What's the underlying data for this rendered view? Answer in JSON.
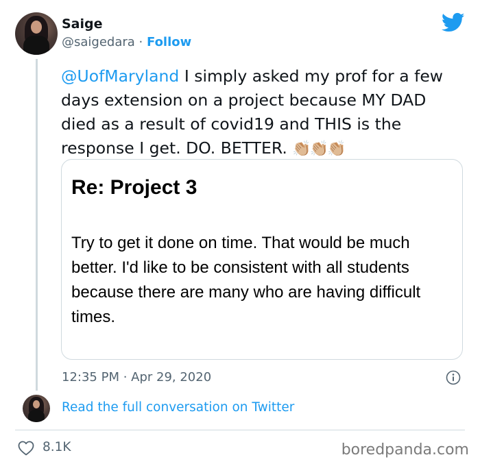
{
  "author": {
    "name": "Saige",
    "handle": "@saigedara",
    "separator": "·",
    "follow_label": "Follow"
  },
  "tweet": {
    "mention": "@UofMaryland",
    "text": " I simply asked my prof for a few days extension on a project because MY DAD died as a result of covid19 and THIS is the response I get. DO. BETTER. ",
    "emoji": "👏🏼👏🏼👏🏼"
  },
  "email_card": {
    "title": "Re:  Project 3",
    "body": "Try to get it done on time.  That would be much better.  I'd like to be consistent with all students because there are many who are having difficult times."
  },
  "meta": {
    "timestamp": "12:35 PM · Apr 29, 2020",
    "read_more": "Read the full conversation on Twitter",
    "likes": "8.1K"
  },
  "watermark": "boredpanda.com",
  "colors": {
    "link": "#1d9bf0",
    "muted": "#536471",
    "border": "#cfd9de"
  },
  "icons": {
    "brand": "twitter-bird-icon",
    "info": "info-icon",
    "like": "heart-icon"
  }
}
